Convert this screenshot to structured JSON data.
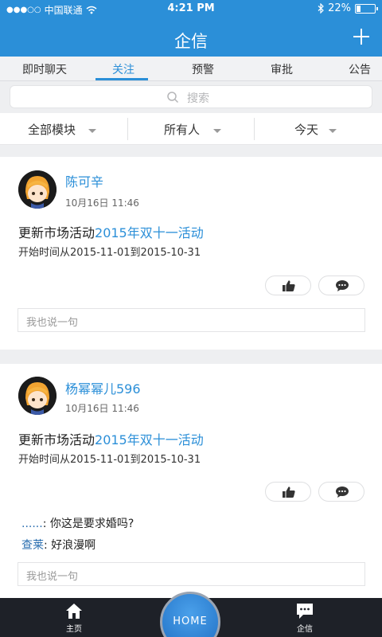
{
  "status_bar": {
    "carrier": "中国联通",
    "time": "4:21 PM",
    "battery_text": "22%",
    "battery_level": 0.22
  },
  "header": {
    "title": "企信"
  },
  "tabs": [
    {
      "label": "即时聊天"
    },
    {
      "label": "关注"
    },
    {
      "label": "预警"
    },
    {
      "label": "审批"
    },
    {
      "label": "公告"
    }
  ],
  "search": {
    "placeholder": "搜索"
  },
  "filters": [
    {
      "label": "全部模块"
    },
    {
      "label": "所有人"
    },
    {
      "label": "今天"
    }
  ],
  "posts": [
    {
      "user": "陈可辛",
      "time": "10月16日 11:46",
      "action": "更新市场活动",
      "link": "2015年双十一活动",
      "detail": "开始时间从2015-11-01到2015-10-31",
      "comment_placeholder": "我也说一句"
    },
    {
      "user": "杨幂幂儿596",
      "time": "10月16日 11:46",
      "action": "更新市场活动",
      "link": "2015年双十一活动",
      "detail": "开始时间从2015-11-01到2015-10-31",
      "replies": [
        {
          "who": "......",
          "text": ": 你这是要求婚吗?"
        },
        {
          "who": "查莱",
          "text": ": 好浪漫啊"
        }
      ],
      "comment_placeholder": "我也说一句"
    }
  ],
  "bottom_nav": {
    "home": "主页",
    "center": "HOME",
    "qixin": "企信"
  },
  "colors": {
    "brand": "#2b8fd8",
    "nav_bg": "#1e2128"
  }
}
